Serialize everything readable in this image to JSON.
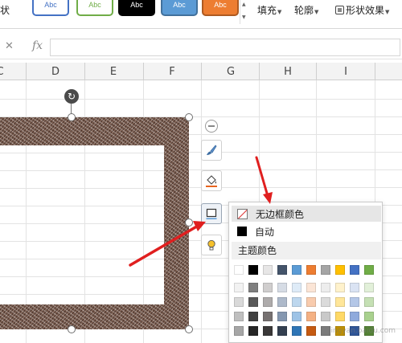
{
  "ribbon": {
    "cut_label": "状",
    "style_swatches": [
      {
        "label": "Abc",
        "fill": "#ffffff",
        "border": "#4472c4",
        "text": "#4472c4"
      },
      {
        "label": "Abc",
        "fill": "#ffffff",
        "border": "#70ad47",
        "text": "#70ad47"
      },
      {
        "label": "Abc",
        "fill": "#000000",
        "border": "#000000",
        "text": "#ffffff"
      },
      {
        "label": "Abc",
        "fill": "#5b9bd5",
        "border": "#41719c",
        "text": "#ffffff"
      },
      {
        "label": "Abc",
        "fill": "#ed7d31",
        "border": "#ae5a21",
        "text": "#ffffff"
      }
    ],
    "fill_label": "填充",
    "outline_label": "轮廓",
    "effects_label": "形状效果"
  },
  "formula_bar": {
    "cancel_glyph": "✕",
    "fx_label": "fx",
    "value": ""
  },
  "sheet": {
    "columns": [
      "C",
      "D",
      "E",
      "F",
      "G",
      "H",
      "I"
    ]
  },
  "side_toolbar": {
    "buttons": [
      "collapse",
      "style",
      "fill",
      "outline",
      "smart"
    ]
  },
  "outline_menu": {
    "no_border_label": "无边框颜色",
    "auto_label": "自动",
    "theme_colors_label": "主题颜色",
    "theme_colors": [
      [
        "#ffffff",
        "#000000",
        "#e7e6e6",
        "#44546a",
        "#5b9bd5",
        "#ed7d31",
        "#a5a5a5",
        "#ffc000",
        "#4472c4",
        "#70ad47"
      ],
      [
        "#f2f2f2",
        "#7f7f7f",
        "#d0cece",
        "#d6dce5",
        "#deebf7",
        "#fbe5d6",
        "#ededed",
        "#fff2cc",
        "#dae3f3",
        "#e2f0d9"
      ],
      [
        "#d9d9d9",
        "#595959",
        "#aeabab",
        "#adb9ca",
        "#bdd7ee",
        "#f8cbad",
        "#dbdbdb",
        "#ffe699",
        "#b4c7e7",
        "#c5e0b4"
      ],
      [
        "#bfbfbf",
        "#404040",
        "#767171",
        "#8497b0",
        "#9dc3e6",
        "#f4b183",
        "#c9c9c9",
        "#ffd966",
        "#8faadc",
        "#a9d18e"
      ],
      [
        "#a6a6a6",
        "#262626",
        "#3a3838",
        "#333f50",
        "#2e75b6",
        "#c55a11",
        "#7b7b7b",
        "#bf9000",
        "#2f5597",
        "#548235"
      ]
    ]
  },
  "watermark": "jingyan.baidu.com"
}
